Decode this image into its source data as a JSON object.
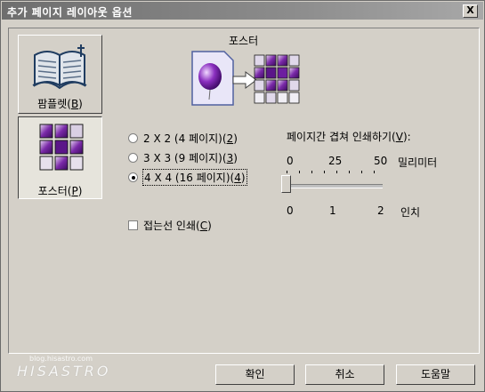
{
  "window": {
    "title": "추가 페이지 레이아웃 옵션",
    "close_label": "X"
  },
  "modes": {
    "booklet": {
      "label": "팜플렛",
      "mnemonic": "B"
    },
    "poster": {
      "label": "포스터",
      "mnemonic": "P"
    }
  },
  "section": {
    "title": "포스터"
  },
  "layout_options": [
    {
      "label": "2 X 2 (4 페이지)",
      "mnemonic": "2",
      "selected": false
    },
    {
      "label": "3 X 3 (9 페이지)",
      "mnemonic": "3",
      "selected": false
    },
    {
      "label": "4 X 4 (16 페이지)",
      "mnemonic": "4",
      "selected": true
    }
  ],
  "overlap": {
    "label": "페이지간 겹쳐 인쇄하기",
    "mnemonic": "V",
    "mm_ticks": [
      "0",
      "25",
      "50"
    ],
    "mm_unit": "밀리미터",
    "inch_ticks": [
      "0",
      "1",
      "2"
    ],
    "inch_unit": "인치",
    "value": 0
  },
  "cutline": {
    "label": "접는선 인쇄",
    "mnemonic": "C",
    "checked": false
  },
  "buttons": {
    "ok": "확인",
    "cancel": "취소",
    "help": "도움말"
  },
  "watermark": {
    "small": "blog.hisastro.com",
    "big": "HISASTRO"
  }
}
